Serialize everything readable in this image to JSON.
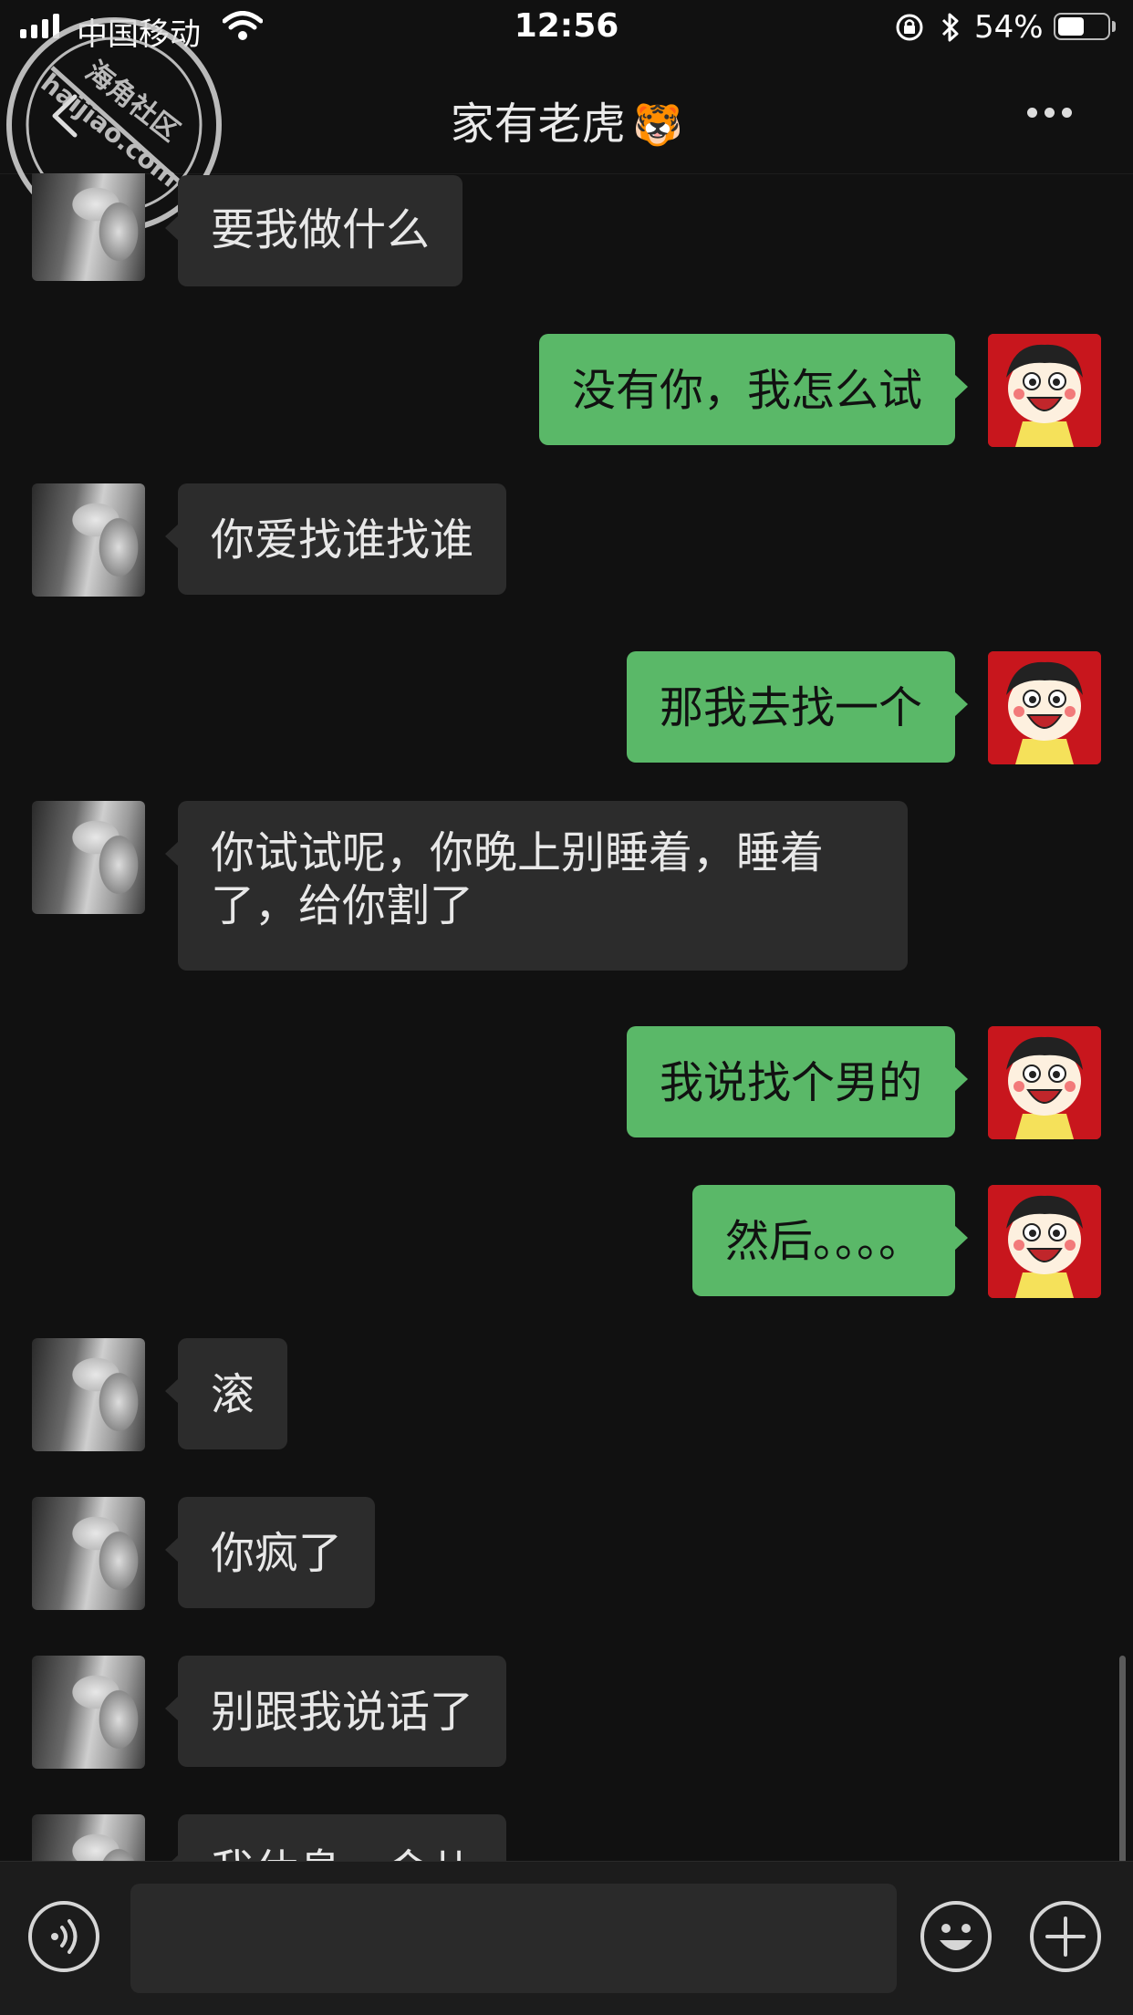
{
  "status_bar": {
    "carrier": "中国移动",
    "time": "12:56",
    "battery_percent": "54%",
    "battery_level": 0.54,
    "icons": [
      "signal-icon",
      "wifi-icon",
      "rotation-lock-icon",
      "bluetooth-icon",
      "battery-icon"
    ]
  },
  "nav": {
    "title": "家有老虎",
    "title_emoji": "🐯",
    "icons": [
      "back-icon",
      "more-icon"
    ]
  },
  "watermark": {
    "text_1": "海角社区",
    "text_2": "haijiao.com"
  },
  "messages": [
    {
      "side": "in",
      "text": "要我做什么"
    },
    {
      "side": "out",
      "text": "没有你，我怎么试"
    },
    {
      "side": "in",
      "text": "你爱找谁找谁"
    },
    {
      "side": "out",
      "text": "那我去找一个"
    },
    {
      "side": "in",
      "text": "你试试呢，你晚上别睡着，睡着了，给你割了"
    },
    {
      "side": "out",
      "text": "我说找个男的"
    },
    {
      "side": "out",
      "text": "然后。。。。"
    },
    {
      "side": "in",
      "text": "滚"
    },
    {
      "side": "in",
      "text": "你疯了"
    },
    {
      "side": "in",
      "text": "别跟我说话了"
    },
    {
      "side": "in",
      "text": "我休息一会儿"
    }
  ],
  "input_bar": {
    "placeholder": "",
    "icons": [
      "voice-icon",
      "emoji-icon",
      "add-icon"
    ]
  },
  "colors": {
    "background": "#111111",
    "incoming_bubble": "#2c2c2c",
    "outgoing_bubble": "#5ab868",
    "input_bar": "#1c1c1c"
  }
}
